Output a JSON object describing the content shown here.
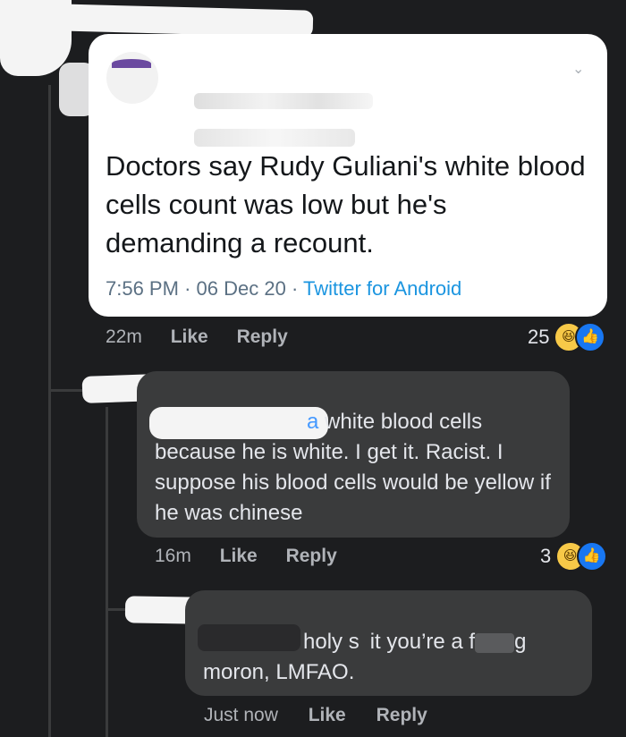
{
  "tweet": {
    "text": "Doctors say Rudy Guliani's white blood cells count was low but he's demanding a recount.",
    "time": "7:56 PM",
    "date": "06 Dec 20",
    "separator": "·",
    "source": "Twitter for Android"
  },
  "post_actions": {
    "time": "22m",
    "like": "Like",
    "reply": "Reply",
    "reaction_count": "25"
  },
  "comment1": {
    "mention_tail": "a",
    "text_line1": " white blood cells",
    "text_rest": "because he is white. I get it. Racist. I suppose his blood cells would be yellow if he was chinese",
    "time": "16m",
    "like": "Like",
    "reply": "Reply",
    "reaction_count": "3"
  },
  "comment2": {
    "text_line1": "holy s",
    "text_line1b": "it you’re a f",
    "text_line1c": "g",
    "text_line2": "moron, LMFAO.",
    "time": "Just now",
    "like": "Like",
    "reply": "Reply"
  },
  "icons": {
    "laugh": "laugh-reaction-icon",
    "like": "like-reaction-icon",
    "chevron": "chevron-down-icon"
  },
  "colors": {
    "background": "#1c1d1f",
    "bubble": "#3a3b3c",
    "twitter_blue": "#1b95e0",
    "facebook_blue": "#1877f2"
  }
}
